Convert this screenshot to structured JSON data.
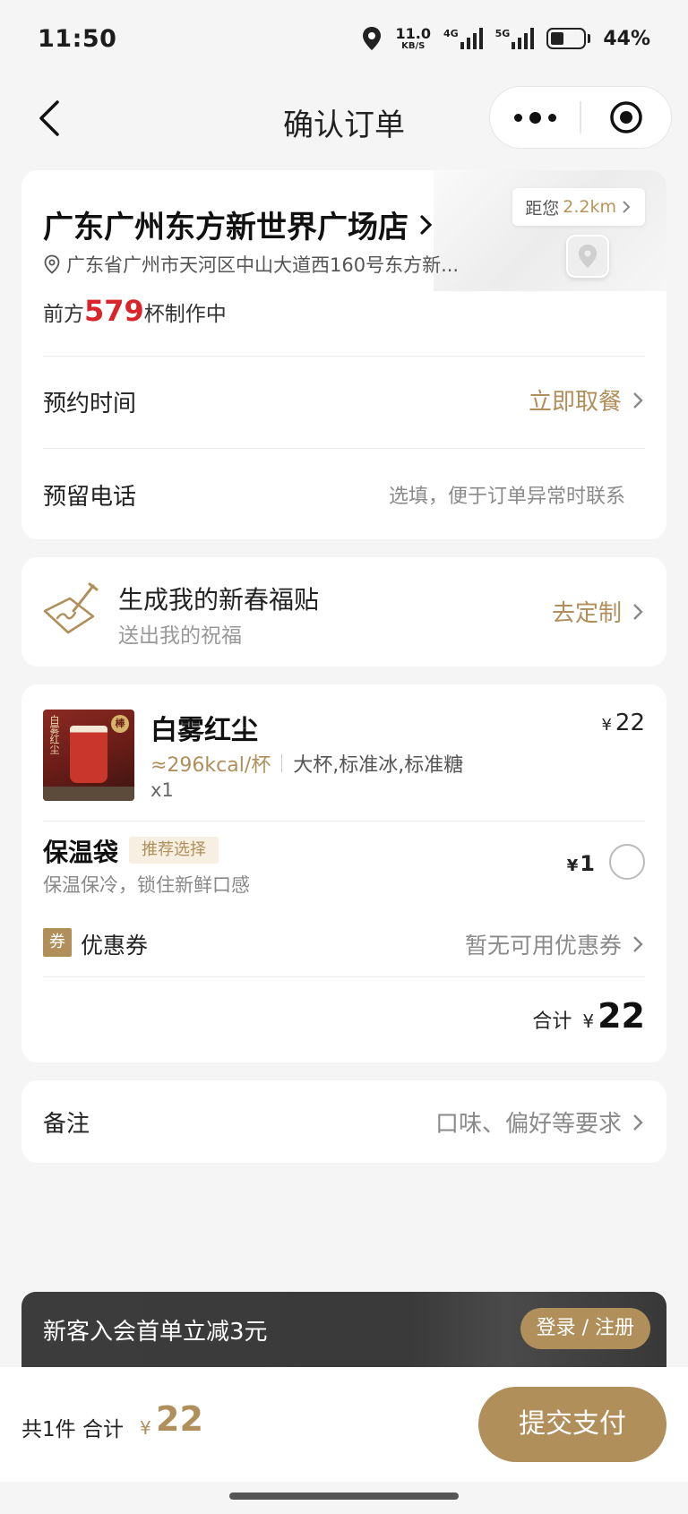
{
  "status_bar": {
    "time": "11:50",
    "net_speed": "11.0",
    "net_unit": "KB/S",
    "net_4g": "4G",
    "net_5g": "5G",
    "battery": "44%"
  },
  "nav": {
    "title": "确认订单"
  },
  "store": {
    "name": "广东广州东方新世界广场店",
    "address": "广东省广州市天河区中山大道西160号东方新...",
    "distance_prefix": "距您",
    "distance": "2.2km",
    "queue_prefix": "前方",
    "queue_count": "579",
    "queue_suffix": "杯制作中"
  },
  "reserve": {
    "label": "预约时间",
    "value": "立即取餐"
  },
  "phone": {
    "label": "预留电话",
    "placeholder": "选填，便于订单异常时联系"
  },
  "blessing": {
    "title": "生成我的新春福贴",
    "subtitle": "送出我的祝福",
    "action": "去定制"
  },
  "product": {
    "image_text": "白雾红尘",
    "image_badge": "棒",
    "name": "白雾红尘",
    "currency": "¥",
    "price": "22",
    "kcal": "≈296kcal/杯",
    "options": "大杯,标准冰,标准糖",
    "qty": "x1"
  },
  "bag": {
    "name": "保温袋",
    "tag": "推荐选择",
    "desc": "保温保冷，锁住新鲜口感",
    "currency": "¥",
    "price": "1"
  },
  "coupon": {
    "badge": "券",
    "label": "优惠券",
    "value": "暂无可用优惠券"
  },
  "subtotal": {
    "label": "合计",
    "currency": "¥",
    "amount": "22"
  },
  "remark": {
    "label": "备注",
    "placeholder": "口味、偏好等要求"
  },
  "promo": {
    "text": "新客入会首单立减3元",
    "button": "登录 / 注册"
  },
  "footer": {
    "count": "共1件  合计",
    "currency": "¥",
    "amount": "22",
    "submit": "提交支付"
  },
  "colors": {
    "accent_gold": "#b08f5b",
    "queue_red": "#d9252a",
    "promo_dark": "#3c3c3c"
  }
}
